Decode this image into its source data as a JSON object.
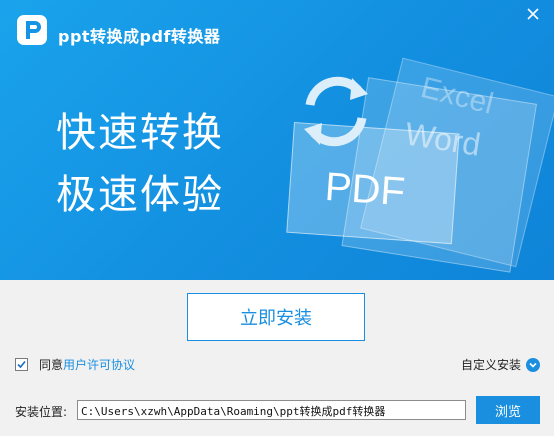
{
  "window": {
    "title": "ppt转换成pdf转换器",
    "logo_icon": "app-logo-p-icon",
    "close_icon": "close-icon"
  },
  "banner": {
    "line1": "快速转换",
    "line2": "极速体验",
    "art_labels": [
      "Excel",
      "Word",
      "PDF"
    ],
    "accent_color": "#1a8fe0"
  },
  "actions": {
    "install_label": "立即安装",
    "agree_prefix": "同意",
    "agree_link": "用户许可协议",
    "agree_checked": true,
    "custom_install_label": "自定义安装",
    "custom_install_icon": "chevron-down-icon"
  },
  "install_path": {
    "label": "安装位置:",
    "value": "C:\\Users\\xzwh\\AppData\\Roaming\\ppt转换成pdf转换器",
    "browse_label": "浏览"
  }
}
